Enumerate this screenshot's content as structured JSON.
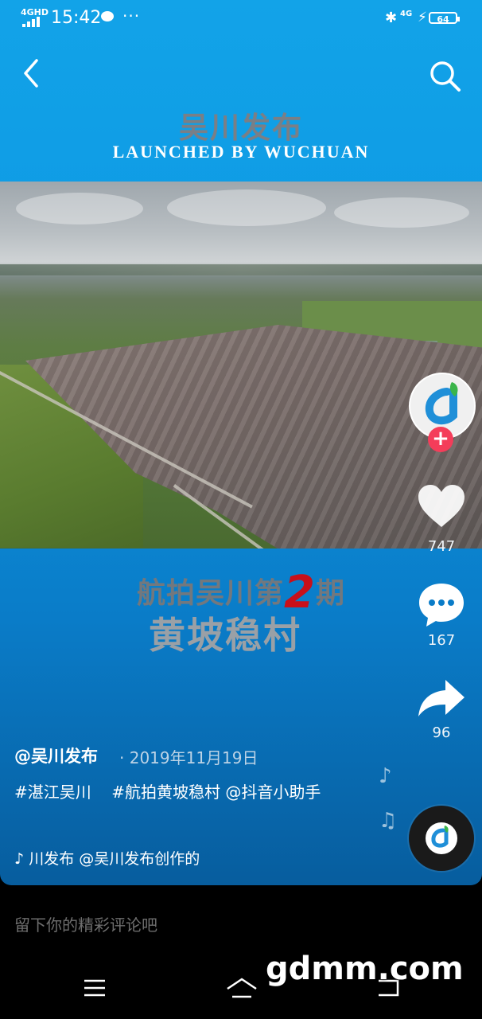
{
  "status_bar": {
    "network": "4GHD",
    "time": "15:42",
    "more": "···",
    "network_right": "4G",
    "battery": "64"
  },
  "video": {
    "brand_cn": "吴川发布",
    "brand_en": "LAUNCHED BY WUCHUAN",
    "title_line1_pre": "航拍吴川第",
    "title_line1_num": "2",
    "title_line1_post": "期",
    "title_line2": "黄坡稳村"
  },
  "rail": {
    "like_count": "747",
    "comment_count": "167",
    "share_count": "96"
  },
  "caption": {
    "author": "@吴川发布",
    "date": "· 2019年11月19日",
    "tag1": "#湛江吴川",
    "tag2": "#航拍黄坡稳村",
    "mention": "@抖音小助手",
    "music": "川发布    @吴川发布创作的"
  },
  "comment_placeholder": "留下你的精彩评论吧",
  "watermark": "gdmm.com",
  "colors": {
    "accent_like": "#f43d5a",
    "video_bg": "#0e9ae4"
  },
  "icons": [
    "back-icon",
    "search-icon",
    "heart-icon",
    "comment-icon",
    "share-icon",
    "music-note-icon",
    "menu-icon",
    "home-icon",
    "back-nav-icon"
  ]
}
